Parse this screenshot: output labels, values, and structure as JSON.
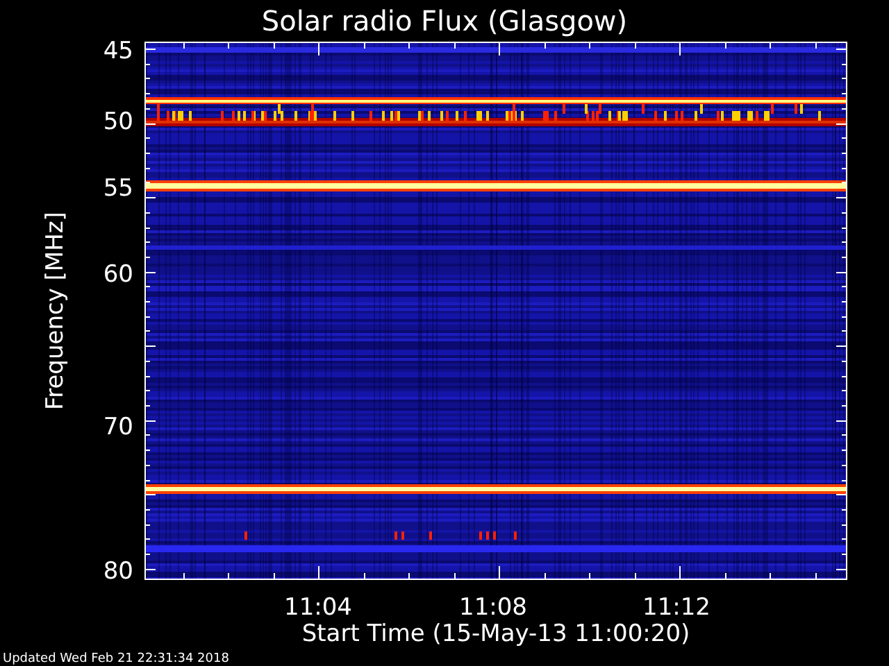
{
  "title": "Solar radio Flux (Glasgow)",
  "y_axis": {
    "label": "Frequency [MHz]",
    "ticks": [
      "45",
      "50",
      "55",
      "60",
      "70",
      "80"
    ]
  },
  "x_axis": {
    "label": "Start Time (15-May-13 11:00:20)",
    "ticks": [
      "11:04",
      "11:08",
      "11:12"
    ]
  },
  "footer": "Updated Wed Feb 21 22:31:34 2018"
}
